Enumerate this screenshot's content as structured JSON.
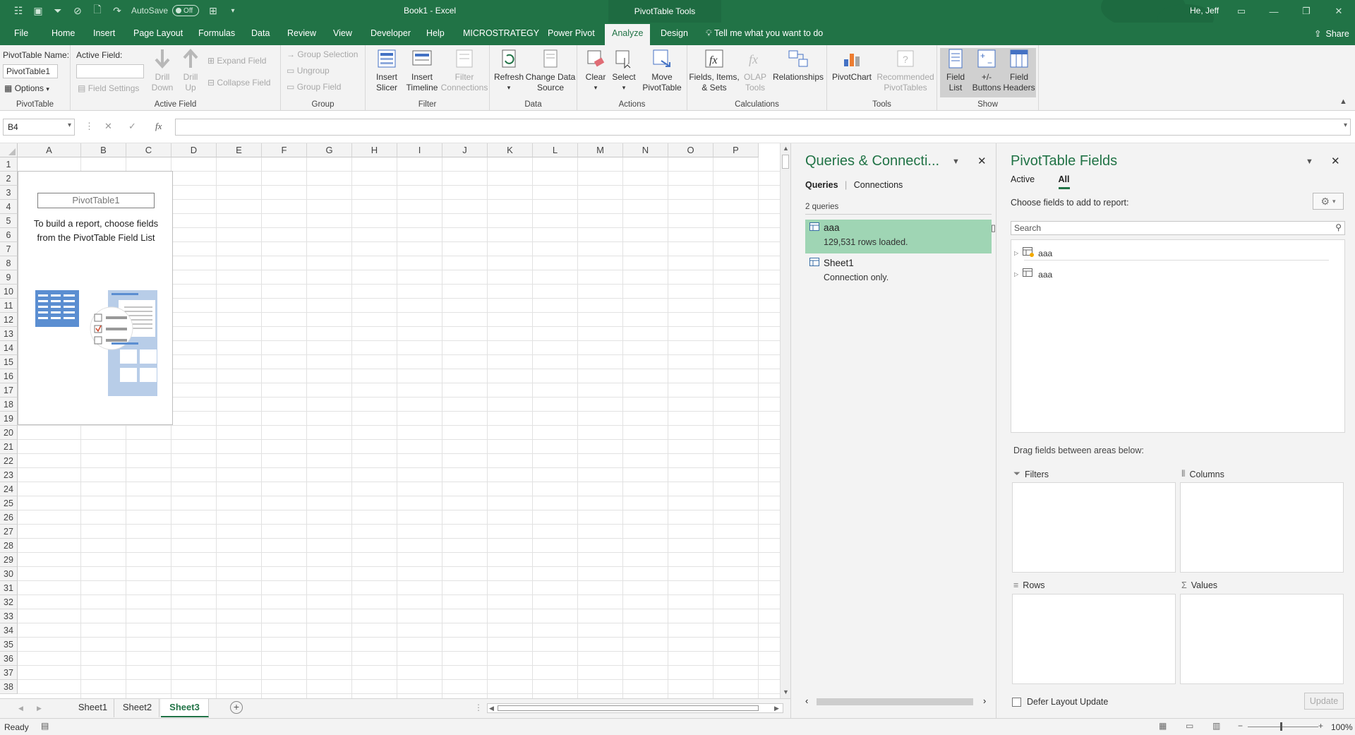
{
  "titlebar": {
    "autosave_label": "AutoSave",
    "autosave_state": "Off",
    "document_title": "Book1  -  Excel",
    "context_title": "PivotTable Tools",
    "user": "He, Jeff"
  },
  "tabs": [
    "File",
    "Home",
    "Insert",
    "Page Layout",
    "Formulas",
    "Data",
    "Review",
    "View",
    "Developer",
    "Help",
    "MICROSTRATEGY",
    "Power Pivot",
    "Analyze",
    "Design"
  ],
  "tell_me": "Tell me what you want to do",
  "share": "Share",
  "ribbon": {
    "pivottable": {
      "name_label": "PivotTable Name:",
      "name_value": "PivotTable1",
      "options": "Options",
      "group": "PivotTable"
    },
    "active_field": {
      "label": "Active Field:",
      "field_settings": "Field Settings",
      "drill_down": [
        "Drill",
        "Down"
      ],
      "drill_up": [
        "Drill",
        "Up"
      ],
      "expand": "Expand Field",
      "collapse": "Collapse Field",
      "group": "Active Field"
    },
    "group": {
      "group_selection": "Group Selection",
      "ungroup": "Ungroup",
      "group_field": "Group Field",
      "group": "Group"
    },
    "filter": {
      "insert_slicer": [
        "Insert",
        "Slicer"
      ],
      "insert_timeline": [
        "Insert",
        "Timeline"
      ],
      "filter_connections": [
        "Filter",
        "Connections"
      ],
      "group": "Filter"
    },
    "data": {
      "refresh": "Refresh",
      "change_data_source": [
        "Change Data",
        "Source"
      ],
      "group": "Data"
    },
    "actions": {
      "clear": "Clear",
      "select": "Select",
      "move": [
        "Move",
        "PivotTable"
      ],
      "group": "Actions"
    },
    "calculations": {
      "fields_items": [
        "Fields, Items,",
        "& Sets"
      ],
      "olap": [
        "OLAP",
        "Tools"
      ],
      "relationships": "Relationships",
      "group": "Calculations"
    },
    "tools": {
      "pivotchart": "PivotChart",
      "recommended": [
        "Recommended",
        "PivotTables"
      ],
      "group": "Tools"
    },
    "show": {
      "field_list": [
        "Field",
        "List"
      ],
      "buttons": [
        "+/-",
        "Buttons"
      ],
      "headers": [
        "Field",
        "Headers"
      ],
      "group": "Show"
    }
  },
  "formula_bar": {
    "name_box": "B4",
    "formula": ""
  },
  "grid": {
    "columns": [
      "A",
      "B",
      "C",
      "D",
      "E",
      "F",
      "G",
      "H",
      "I",
      "J",
      "K",
      "L",
      "M",
      "N",
      "O",
      "P"
    ],
    "rows": [
      "1",
      "2",
      "3",
      "4",
      "5",
      "6",
      "7",
      "8",
      "9",
      "10",
      "11",
      "12",
      "13",
      "14",
      "15",
      "16",
      "17",
      "18",
      "19",
      "20",
      "21",
      "22",
      "23",
      "24",
      "25",
      "26",
      "27",
      "28",
      "29",
      "30",
      "31",
      "32",
      "33",
      "34",
      "35",
      "36",
      "37",
      "38"
    ]
  },
  "pivot_placeholder": {
    "name": "PivotTable1",
    "line1": "To build a report, choose fields",
    "line2": "from the PivotTable Field List"
  },
  "sheets": [
    "Sheet1",
    "Sheet2",
    "Sheet3"
  ],
  "active_sheet": "Sheet3",
  "queries_pane": {
    "title": "Queries & Connecti...",
    "tab_queries": "Queries",
    "tab_connections": "Connections",
    "count": "2 queries",
    "items": [
      {
        "name": "aaa",
        "sub": "129,531 rows loaded."
      },
      {
        "name": "Sheet1",
        "sub": "Connection only."
      }
    ]
  },
  "fields_pane": {
    "title": "PivotTable Fields",
    "tab_active": "Active",
    "tab_all": "All",
    "choose": "Choose fields to add to report:",
    "search_placeholder": "Search",
    "fields": [
      "aaa",
      "aaa"
    ],
    "drag_text": "Drag fields between areas below:",
    "areas": {
      "filters": "Filters",
      "columns": "Columns",
      "rows": "Rows",
      "values": "Values"
    },
    "defer": "Defer Layout Update",
    "update": "Update"
  },
  "status": {
    "ready": "Ready",
    "zoom": "100%"
  },
  "colors": {
    "brand": "#217346",
    "selected_query": "#9fd5b4"
  }
}
